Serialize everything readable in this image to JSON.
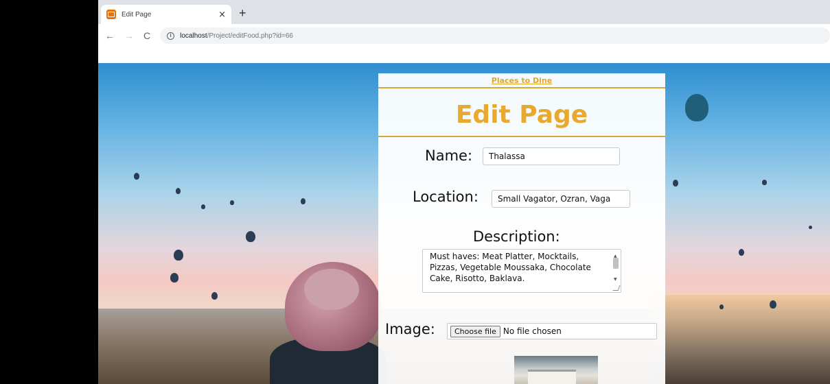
{
  "browser": {
    "tab_title": "Edit Page",
    "tab_close": "×",
    "new_tab": "+",
    "nav": {
      "back": "←",
      "forward": "→",
      "reload": "C"
    },
    "url_host": "localhost",
    "url_path": "/Project/editFood.php?id=66"
  },
  "page": {
    "nav_link": "Places to Dine",
    "title": "Edit Page",
    "name_label": "Name:",
    "name_value": "Thalassa",
    "location_label": "Location:",
    "location_value": "Small Vagator, Ozran, Vaga",
    "description_label": "Description:",
    "description_value": "Must haves: Meat Platter, Mocktails, Pizzas, Vegetable Moussaka, Chocolate Cake, Risotto, Baklava.",
    "image_label": "Image:",
    "file_button": "Choose file",
    "file_status": "No file chosen"
  },
  "colors": {
    "accent": "#e8a92e",
    "rule": "#d9a63a"
  }
}
